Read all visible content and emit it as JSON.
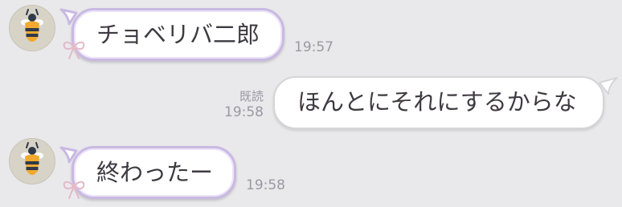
{
  "messages": [
    {
      "side": "incoming",
      "text": "チョベリバ二郎",
      "time": "19:57",
      "avatar_icon": "bee-icon",
      "decoration_icon": "ribbon-bow-icon"
    },
    {
      "side": "outgoing",
      "text": "ほんとにそれにするからな",
      "time": "19:58",
      "read_label": "既読"
    },
    {
      "side": "incoming",
      "text": "終わったー",
      "time": "19:58",
      "avatar_icon": "bee-icon",
      "decoration_icon": "ribbon-bow-icon"
    }
  ],
  "colors": {
    "background": "#e9e9ec",
    "incoming_bubble_border": "#c9b9e3",
    "outgoing_bubble_border": "#d5d5d8",
    "meta_text": "#9a99a0",
    "ribbon": "#e4b9c8"
  }
}
